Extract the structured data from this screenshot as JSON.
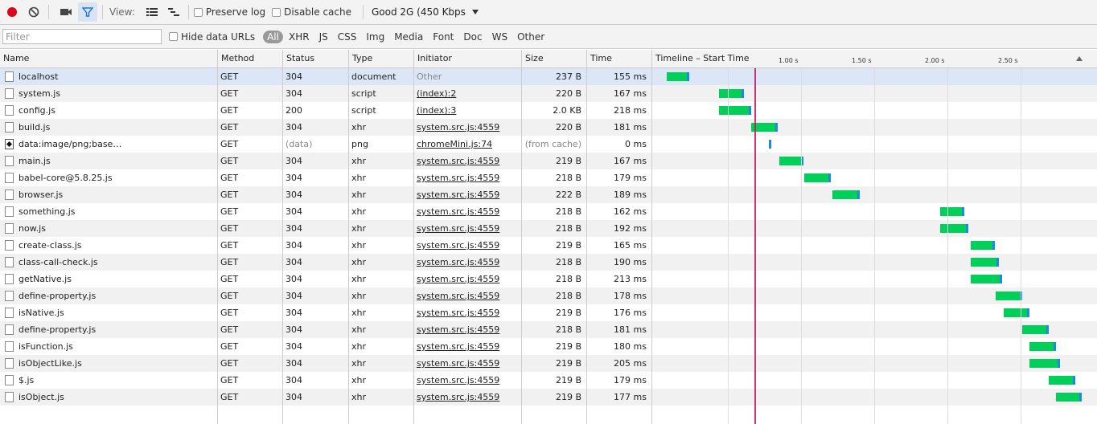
{
  "toolbar": {
    "view_label": "View:",
    "preserve_log": "Preserve log",
    "disable_cache": "Disable cache",
    "throttle": "Good 2G (450 Kbps"
  },
  "filter": {
    "placeholder": "Filter",
    "hide_data_urls": "Hide data URLs",
    "types": [
      "All",
      "XHR",
      "JS",
      "CSS",
      "Img",
      "Media",
      "Font",
      "Doc",
      "WS",
      "Other"
    ]
  },
  "columns": {
    "name": "Name",
    "method": "Method",
    "status": "Status",
    "type": "Type",
    "initiator": "Initiator",
    "size": "Size",
    "time": "Time",
    "timeline": "Timeline – Start Time"
  },
  "timeline_ticks": [
    "1.00 s",
    "1.50 s",
    "2.00 s",
    "2.50 s"
  ],
  "colors": {
    "waiting": "#00d05a",
    "receiving": "#1e88e5",
    "marker": "#c2185b",
    "record": "#e0001b"
  },
  "requests": [
    {
      "name": "localhost",
      "method": "GET",
      "status": "304",
      "type": "document",
      "initiator": "Other",
      "size": "237 B",
      "time": "155 ms",
      "start": 0.06,
      "dur": 0.155
    },
    {
      "name": "system.js",
      "method": "GET",
      "status": "304",
      "type": "script",
      "initiator": "(index):2",
      "size": "220 B",
      "time": "167 ms",
      "start": 0.42,
      "dur": 0.167
    },
    {
      "name": "config.js",
      "method": "GET",
      "status": "200",
      "type": "script",
      "initiator": "(index):3",
      "size": "2.0 KB",
      "time": "218 ms",
      "start": 0.42,
      "dur": 0.218
    },
    {
      "name": "build.js",
      "method": "GET",
      "status": "304",
      "type": "xhr",
      "initiator": "system.src.js:4559",
      "size": "220 B",
      "time": "181 ms",
      "start": 0.64,
      "dur": 0.181
    },
    {
      "name": "data:image/png;base…",
      "method": "GET",
      "status": "(data)",
      "type": "png",
      "initiator": "chromeMini.js:74",
      "size": "(from cache)",
      "time": "0 ms",
      "start": 0.76,
      "dur": 0.0
    },
    {
      "name": "main.js",
      "method": "GET",
      "status": "304",
      "type": "xhr",
      "initiator": "system.src.js:4559",
      "size": "219 B",
      "time": "167 ms",
      "start": 0.83,
      "dur": 0.167
    },
    {
      "name": "babel-core@5.8.25.js",
      "method": "GET",
      "status": "304",
      "type": "xhr",
      "initiator": "system.src.js:4559",
      "size": "218 B",
      "time": "179 ms",
      "start": 1.0,
      "dur": 0.179
    },
    {
      "name": "browser.js",
      "method": "GET",
      "status": "304",
      "type": "xhr",
      "initiator": "system.src.js:4559",
      "size": "222 B",
      "time": "189 ms",
      "start": 1.19,
      "dur": 0.189
    },
    {
      "name": "something.js",
      "method": "GET",
      "status": "304",
      "type": "xhr",
      "initiator": "system.src.js:4559",
      "size": "218 B",
      "time": "162 ms",
      "start": 1.93,
      "dur": 0.162
    },
    {
      "name": "now.js",
      "method": "GET",
      "status": "304",
      "type": "xhr",
      "initiator": "system.src.js:4559",
      "size": "218 B",
      "time": "192 ms",
      "start": 1.93,
      "dur": 0.192
    },
    {
      "name": "create-class.js",
      "method": "GET",
      "status": "304",
      "type": "xhr",
      "initiator": "system.src.js:4559",
      "size": "219 B",
      "time": "165 ms",
      "start": 2.14,
      "dur": 0.165
    },
    {
      "name": "class-call-check.js",
      "method": "GET",
      "status": "304",
      "type": "xhr",
      "initiator": "system.src.js:4559",
      "size": "218 B",
      "time": "190 ms",
      "start": 2.14,
      "dur": 0.19
    },
    {
      "name": "getNative.js",
      "method": "GET",
      "status": "304",
      "type": "xhr",
      "initiator": "system.src.js:4559",
      "size": "218 B",
      "time": "213 ms",
      "start": 2.14,
      "dur": 0.213
    },
    {
      "name": "define-property.js",
      "method": "GET",
      "status": "304",
      "type": "xhr",
      "initiator": "system.src.js:4559",
      "size": "218 B",
      "time": "178 ms",
      "start": 2.31,
      "dur": 0.178
    },
    {
      "name": "isNative.js",
      "method": "GET",
      "status": "304",
      "type": "xhr",
      "initiator": "system.src.js:4559",
      "size": "219 B",
      "time": "176 ms",
      "start": 2.36,
      "dur": 0.176
    },
    {
      "name": "define-property.js",
      "method": "GET",
      "status": "304",
      "type": "xhr",
      "initiator": "system.src.js:4559",
      "size": "218 B",
      "time": "181 ms",
      "start": 2.49,
      "dur": 0.181
    },
    {
      "name": "isFunction.js",
      "method": "GET",
      "status": "304",
      "type": "xhr",
      "initiator": "system.src.js:4559",
      "size": "219 B",
      "time": "180 ms",
      "start": 2.54,
      "dur": 0.18
    },
    {
      "name": "isObjectLike.js",
      "method": "GET",
      "status": "304",
      "type": "xhr",
      "initiator": "system.src.js:4559",
      "size": "219 B",
      "time": "205 ms",
      "start": 2.54,
      "dur": 0.205
    },
    {
      "name": "$.js",
      "method": "GET",
      "status": "304",
      "type": "xhr",
      "initiator": "system.src.js:4559",
      "size": "219 B",
      "time": "179 ms",
      "start": 2.67,
      "dur": 0.179
    },
    {
      "name": "isObject.js",
      "method": "GET",
      "status": "304",
      "type": "xhr",
      "initiator": "system.src.js:4559",
      "size": "219 B",
      "time": "177 ms",
      "start": 2.72,
      "dur": 0.177
    }
  ],
  "load_marker": 0.66
}
